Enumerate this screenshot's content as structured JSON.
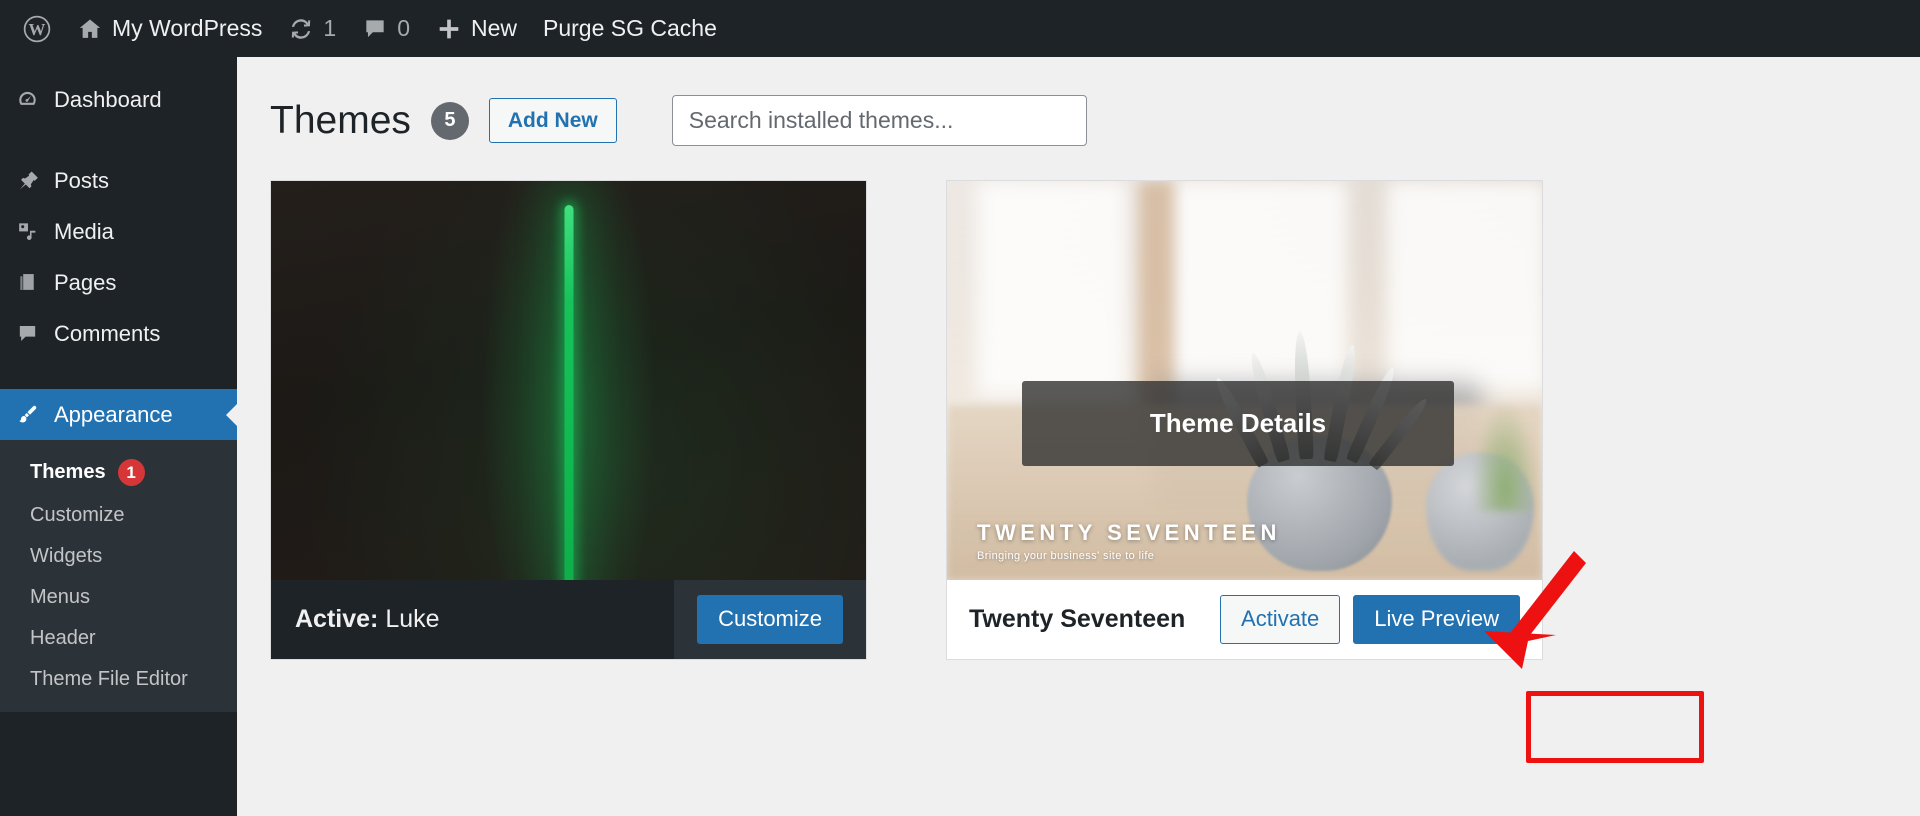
{
  "adminbar": {
    "items": [
      {
        "id": "wp-logo",
        "icon": "wordpress-logo-icon",
        "label": ""
      },
      {
        "id": "site-name",
        "icon": "home-icon",
        "label": "My WordPress"
      },
      {
        "id": "updates",
        "icon": "update-icon",
        "label": "1"
      },
      {
        "id": "comments",
        "icon": "comment-bubble-icon",
        "label": "0"
      },
      {
        "id": "new",
        "icon": "plus-icon",
        "label": "New"
      },
      {
        "id": "purge",
        "icon": "",
        "label": "Purge SG Cache"
      }
    ]
  },
  "sidebar": {
    "items": [
      {
        "label": "Dashboard",
        "icon": "dashboard-icon",
        "current": false
      },
      {
        "label": "Posts",
        "icon": "pin-icon",
        "current": false
      },
      {
        "label": "Media",
        "icon": "media-icon",
        "current": false
      },
      {
        "label": "Pages",
        "icon": "pages-icon",
        "current": false
      },
      {
        "label": "Comments",
        "icon": "comment-bubble-icon",
        "current": false
      },
      {
        "label": "Appearance",
        "icon": "paintbrush-icon",
        "current": true
      }
    ],
    "submenu": [
      {
        "label": "Themes",
        "badge": "1",
        "current": true
      },
      {
        "label": "Customize",
        "badge": "",
        "current": false
      },
      {
        "label": "Widgets",
        "badge": "",
        "current": false
      },
      {
        "label": "Menus",
        "badge": "",
        "current": false
      },
      {
        "label": "Header",
        "badge": "",
        "current": false
      },
      {
        "label": "Theme File Editor",
        "badge": "",
        "current": false
      }
    ]
  },
  "page": {
    "title": "Themes",
    "count": "5",
    "add_new_label": "Add New",
    "search_placeholder": "Search installed themes...",
    "search_value": ""
  },
  "themes": [
    {
      "name": "Luke",
      "active": true,
      "active_label": "Active:",
      "action_label": "Customize",
      "screenshot_alt": "dark-room-green-lightsaber"
    },
    {
      "name": "Twenty Seventeen",
      "active": false,
      "details_label": "Theme Details",
      "activate_label": "Activate",
      "preview_label": "Live Preview",
      "screenshot_alt": "blurred-bright-interior-with-plant",
      "screenshot_brand_title": "TWENTY SEVENTEEN",
      "screenshot_brand_tagline": "Bringing your business' site to life"
    }
  ],
  "annotations": {
    "highlight_color": "#ee1111",
    "arrow_color": "#ee1111",
    "highlight_target": "Live Preview"
  },
  "colors": {
    "admin_dark": "#1d2327",
    "submenu_dark": "#2c3338",
    "accent_blue": "#2271b1",
    "badge_red": "#d63638",
    "content_bg": "#f0f0f1"
  }
}
